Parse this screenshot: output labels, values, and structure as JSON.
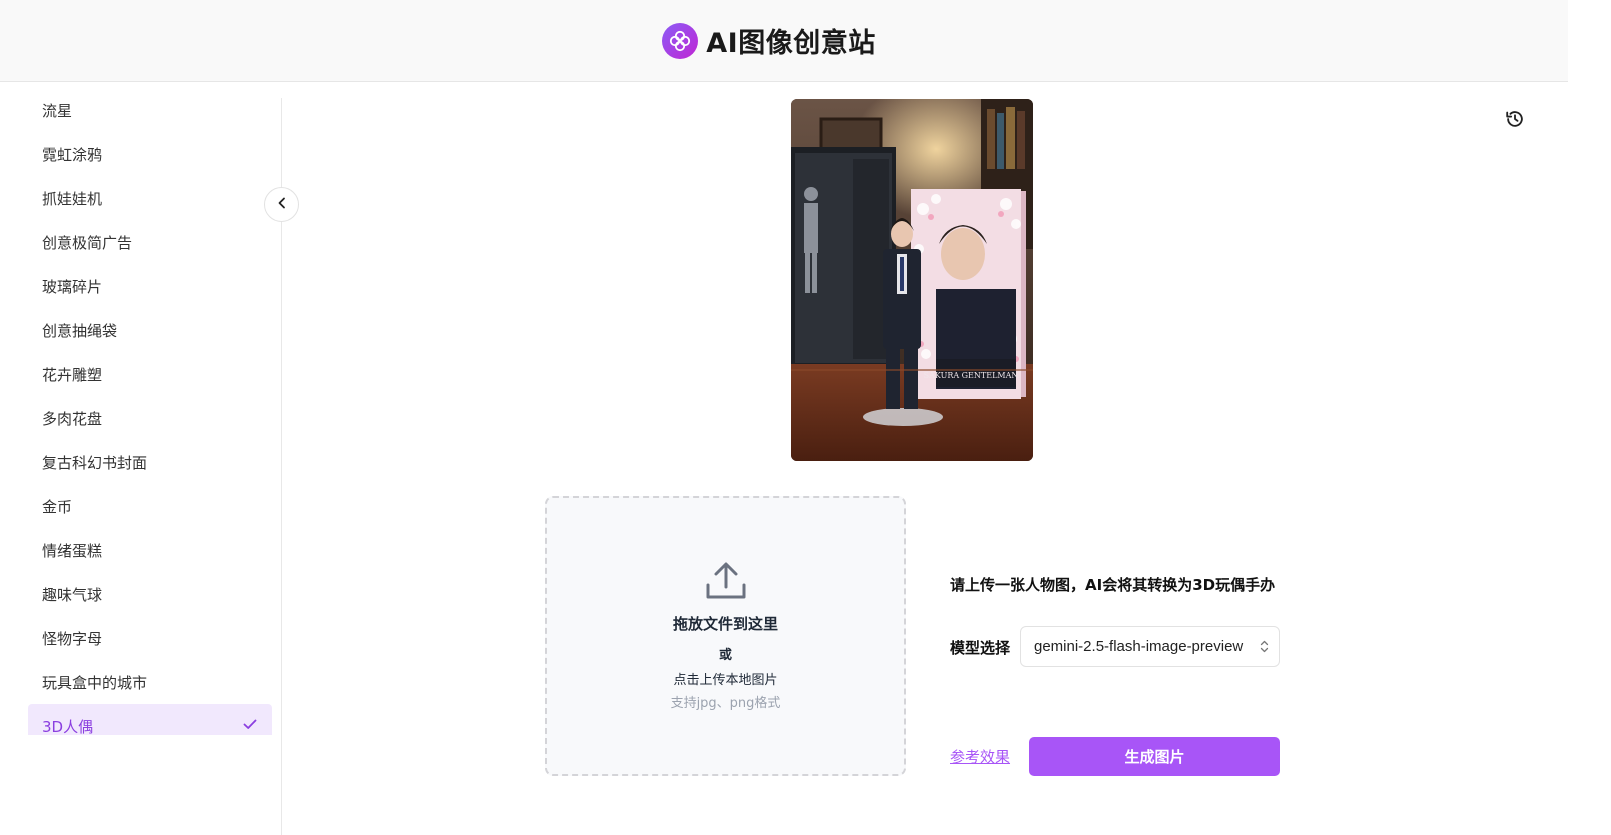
{
  "header": {
    "title": "AI图像创意站"
  },
  "sidebar": {
    "items": [
      {
        "label": "流星"
      },
      {
        "label": "霓虹涂鸦"
      },
      {
        "label": "抓娃娃机"
      },
      {
        "label": "创意极简广告"
      },
      {
        "label": "玻璃碎片"
      },
      {
        "label": "创意抽绳袋"
      },
      {
        "label": "花卉雕塑"
      },
      {
        "label": "多肉花盘"
      },
      {
        "label": "复古科幻书封面"
      },
      {
        "label": "金币"
      },
      {
        "label": "情绪蛋糕"
      },
      {
        "label": "趣味气球"
      },
      {
        "label": "怪物字母"
      },
      {
        "label": "玩具盒中的城市"
      },
      {
        "label": "3D人偶",
        "selected": true
      }
    ]
  },
  "preview": {
    "box_title": "SAKURA GENTELMAN"
  },
  "upload": {
    "main": "拖放文件到这里",
    "or": "或",
    "click": "点击上传本地图片",
    "hint": "支持jpg、png格式"
  },
  "form": {
    "description": "请上传一张人物图，AI会将其转换为3D玩偶手办",
    "model_label": "模型选择",
    "model_value": "gemini-2.5-flash-image-preview",
    "reference_link": "参考效果",
    "generate_button": "生成图片"
  },
  "colors": {
    "accent": "#a855f7",
    "selected_bg": "#f1e8fd"
  },
  "icons": [
    "logo-icon",
    "chevron-left-icon",
    "history-icon",
    "upload-icon",
    "check-icon",
    "select-arrows-icon"
  ]
}
